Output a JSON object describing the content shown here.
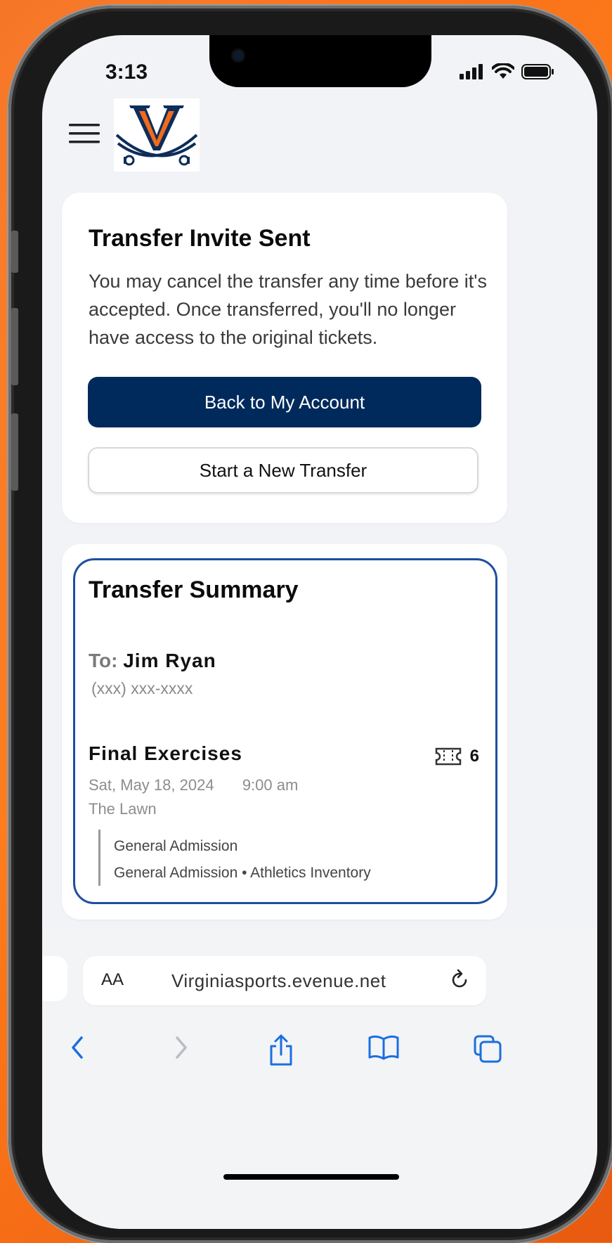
{
  "status_bar": {
    "time": "3:13"
  },
  "header": {
    "logo_letter": "V"
  },
  "invite_card": {
    "title": "Transfer Invite Sent",
    "message": "You may cancel the transfer any time before it's accepted. Once transferred, you'll no longer have access to the original tickets.",
    "primary_button": "Back to My Account",
    "secondary_button": "Start a New Transfer"
  },
  "summary": {
    "title": "Transfer Summary",
    "to_label": "To:",
    "to_name": "Jim Ryan",
    "phone": "(xxx) xxx-xxxx",
    "event_name": "Final Exercises",
    "ticket_count": "6",
    "date": "Sat, May 18, 2024",
    "time": "9:00 am",
    "venue": "The Lawn",
    "section_line1": "General Admission",
    "section_line2": "General Admission • Athletics Inventory"
  },
  "browser": {
    "text_size_label": "AA",
    "url": "Virginiasports.evenue.net"
  },
  "colors": {
    "primary_navy": "#012a5c",
    "uva_orange": "#f26a1b",
    "summary_border": "#1f4ea1"
  }
}
